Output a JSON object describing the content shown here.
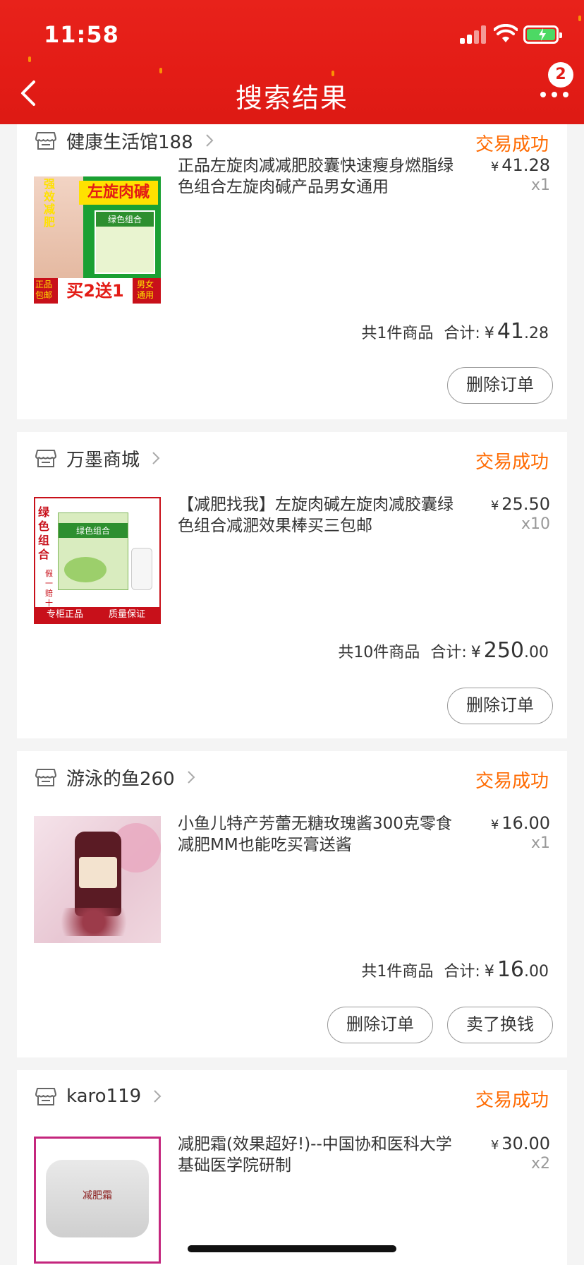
{
  "status_bar": {
    "time": "11:58"
  },
  "header": {
    "title": "搜索结果",
    "message_count": "2"
  },
  "colors": {
    "header_red": "#e31c16",
    "status_orange": "#ff6a00",
    "battery_green": "#4cd964"
  },
  "icons": {
    "back": "chevron-left-icon",
    "more": "ellipsis-icon",
    "store": "store-icon",
    "chevron": "chevron-right-icon"
  },
  "orders": [
    {
      "store": "健康生活馆188",
      "status": "交易成功",
      "title": "正品左旋肉减减肥胶囊快速瘦身燃脂绿色组合左旋肉碱产品男女通用",
      "image_text": {
        "top": "左旋肉碱",
        "side": "强效减肥",
        "bottom_left": "正品包邮",
        "bottom_mid": "买2送1",
        "bottom_right": "男女通用",
        "box_label": "绿色组合"
      },
      "price": "41.28",
      "qty": "x1",
      "summary_count": "共1件商品",
      "summary_label": "合计:",
      "total_int": "41",
      "total_dec": ".28",
      "buttons": [
        "删除订单"
      ]
    },
    {
      "store": "万墨商城",
      "status": "交易成功",
      "title": "【减肥找我】左旋肉碱左旋肉减胶囊绿色组合减淝效果棒买三包邮",
      "image_text": {
        "side": "绿色组合",
        "side2": "假一赔十",
        "bottom_left": "专柜正品",
        "bottom_right": "质量保证",
        "box_label": "绿色组合"
      },
      "price": "25.50",
      "qty": "x10",
      "summary_count": "共10件商品",
      "summary_label": "合计:",
      "total_int": "250",
      "total_dec": ".00",
      "buttons": [
        "删除订单"
      ]
    },
    {
      "store": "游泳的鱼260",
      "status": "交易成功",
      "title": "小鱼儿特产芳蕾无糖玫瑰酱300克零食减肥MM也能吃买膏送酱",
      "image_text": {},
      "price": "16.00",
      "qty": "x1",
      "summary_count": "共1件商品",
      "summary_label": "合计:",
      "total_int": "16",
      "total_dec": ".00",
      "buttons": [
        "删除订单",
        "卖了换钱"
      ]
    },
    {
      "store": "karo119",
      "status": "交易成功",
      "title": "减肥霜(效果超好!)--中国协和医科大学基础医学院研制",
      "image_text": {
        "jar_label": "减肥霜"
      },
      "price": "30.00",
      "qty": "x2"
    }
  ]
}
